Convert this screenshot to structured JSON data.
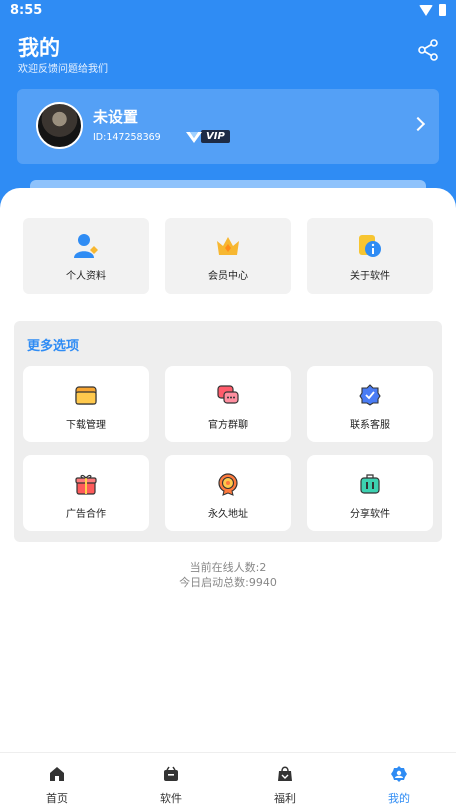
{
  "status_bar": {
    "time": "8:55"
  },
  "header": {
    "title": "我的",
    "subtitle": "欢迎反馈问题给我们",
    "share_icon": "share-icon"
  },
  "user": {
    "name": "未设置",
    "id": "ID:147258369",
    "vip_label": "VIP"
  },
  "top_items": [
    {
      "label": "个人资料",
      "icon": "user-profile-icon"
    },
    {
      "label": "会员中心",
      "icon": "crown-icon"
    },
    {
      "label": "关于软件",
      "icon": "info-icon"
    }
  ],
  "more": {
    "title": "更多选项",
    "items": [
      {
        "label": "下载管理",
        "icon": "folder-icon"
      },
      {
        "label": "官方群聊",
        "icon": "chat-icon"
      },
      {
        "label": "联系客服",
        "icon": "service-badge-icon"
      },
      {
        "label": "广告合作",
        "icon": "gift-icon"
      },
      {
        "label": "永久地址",
        "icon": "medal-icon"
      },
      {
        "label": "分享软件",
        "icon": "suitcase-icon"
      }
    ]
  },
  "stats": {
    "online": "当前在线人数:2",
    "launches": "今日启动总数:9940"
  },
  "nav": [
    {
      "label": "首页",
      "icon": "home-icon",
      "active": false
    },
    {
      "label": "软件",
      "icon": "software-bag-icon",
      "active": false
    },
    {
      "label": "福利",
      "icon": "shopping-bag-icon",
      "active": false
    },
    {
      "label": "我的",
      "icon": "profile-icon",
      "active": true
    }
  ],
  "colors": {
    "primary": "#2f8cf4",
    "tile_bg": "#f2f2f2",
    "panel_bg": "#eeeeee"
  }
}
